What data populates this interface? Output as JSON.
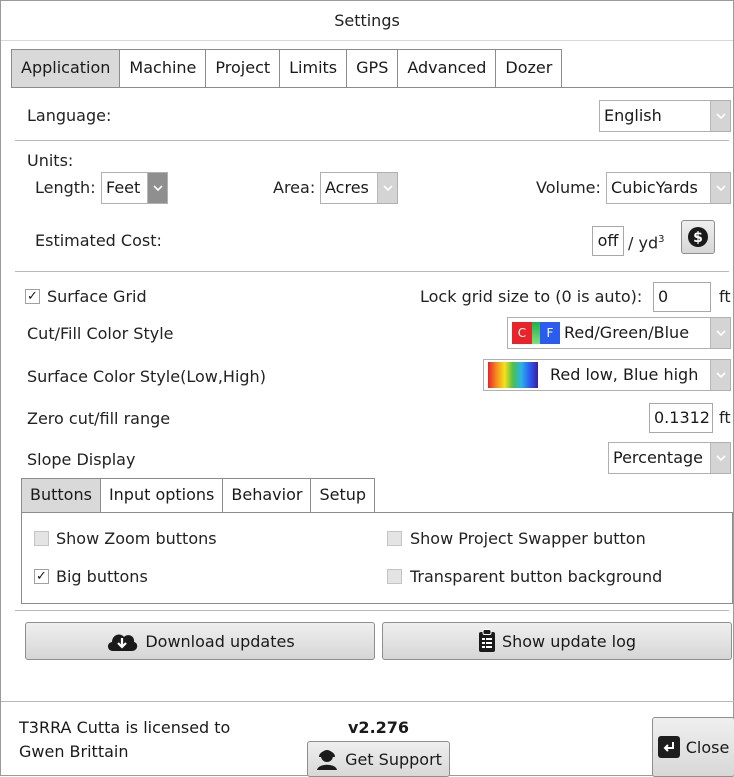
{
  "window": {
    "title": "Settings"
  },
  "tabs": [
    "Application",
    "Machine",
    "Project",
    "Limits",
    "GPS",
    "Advanced",
    "Dozer"
  ],
  "language": {
    "label": "Language:",
    "value": "English"
  },
  "units": {
    "heading": "Units:",
    "length_label": "Length:",
    "length_value": "Feet",
    "area_label": "Area:",
    "area_value": "Acres",
    "volume_label": "Volume:",
    "volume_value": "CubicYards"
  },
  "cost": {
    "label": "Estimated Cost:",
    "value": "off",
    "unit_prefix": "/ yd",
    "unit_sup": "3",
    "icon": "dollar-icon"
  },
  "surface_grid": {
    "label": "Surface Grid",
    "checked": true
  },
  "lock_grid": {
    "label": "Lock grid size to (0 is auto):",
    "value": "0",
    "unit": "ft"
  },
  "cutfill_color": {
    "label": "Cut/Fill Color Style",
    "value": "Red/Green/Blue",
    "swatch_c": "C",
    "swatch_f": "F"
  },
  "surface_color": {
    "label": "Surface Color Style(Low,High)",
    "value": "Red low, Blue high"
  },
  "zero_range": {
    "label": "Zero cut/fill range",
    "value": "0.1312",
    "unit": "ft"
  },
  "slope": {
    "label": "Slope Display",
    "value": "Percentage"
  },
  "subtabs": [
    "Buttons",
    "Input options",
    "Behavior",
    "Setup"
  ],
  "button_options": {
    "show_zoom": "Show Zoom buttons",
    "big_buttons": "Big buttons",
    "show_swapper": "Show Project Swapper button",
    "transparent_bg": "Transparent button background",
    "checkmark": "✓"
  },
  "actions": {
    "download": "Download updates",
    "update_log": "Show update log"
  },
  "footer": {
    "license_line1": "T3RRA Cutta is licensed to",
    "license_line2": "Gwen Brittain",
    "version": "v2.276",
    "support": "Get Support",
    "close": "Close"
  },
  "colors": {
    "tab_active": "#d9d9d9",
    "red": "#e8232a",
    "green": "#19b34a",
    "blue": "#2a5cf0"
  }
}
